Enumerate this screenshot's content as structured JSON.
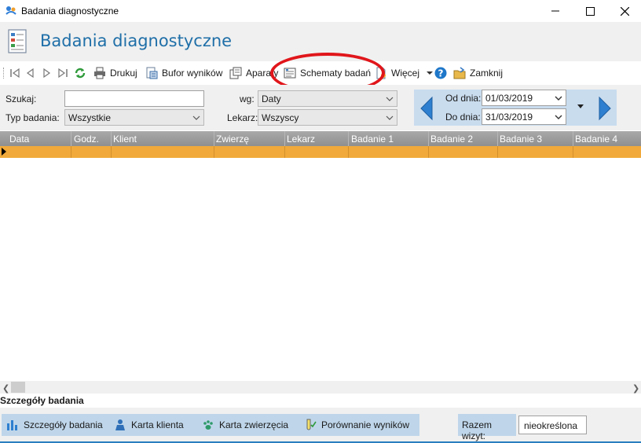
{
  "window": {
    "title": "Badania diagnostyczne",
    "controls": [
      "minimize",
      "maximize",
      "close"
    ]
  },
  "header": {
    "title": "Badania diagnostyczne",
    "icon": "document-list-icon"
  },
  "toolbar": {
    "nav_icons": [
      "first-record-icon",
      "prev-record-icon",
      "next-record-icon",
      "last-record-icon",
      "refresh-icon"
    ],
    "print_label": "Drukuj",
    "buffer_label": "Bufor wyników",
    "devices_label": "Aparaty",
    "schemes_label": "Schematy badań",
    "more_label": "Więcej",
    "close_label": "Zamknij"
  },
  "filters": {
    "search_label": "Szukaj:",
    "search_value": "",
    "by_label": "wg:",
    "by_value": "Daty",
    "type_label": "Typ badania:",
    "type_value": "Wszystkie",
    "vet_label": "Lekarz:",
    "vet_value": "Wszyscy",
    "from_label": "Od dnia:",
    "from_value": "01/03/2019",
    "to_label": "Do dnia:",
    "to_value": "31/03/2019"
  },
  "grid": {
    "columns": [
      "Data",
      "Godz.",
      "Klient",
      "Zwierzę",
      "Lekarz",
      "Badanie 1",
      "Badanie 2",
      "Badanie 3",
      "Badanie 4"
    ],
    "rows": []
  },
  "details": {
    "section_title": "Szczegóły badania",
    "tabs": [
      "Szczegóły badania",
      "Karta klienta",
      "Karta zwierzęcia",
      "Porównanie wyników"
    ],
    "visits_label": "Razem wizyt:",
    "visits_value": "nieokreślona"
  },
  "colors": {
    "accent": "#1f6fa8",
    "selected_row": "#f0a93a",
    "panel_blue": "#bfd6ea",
    "annotation": "#e0161b"
  }
}
